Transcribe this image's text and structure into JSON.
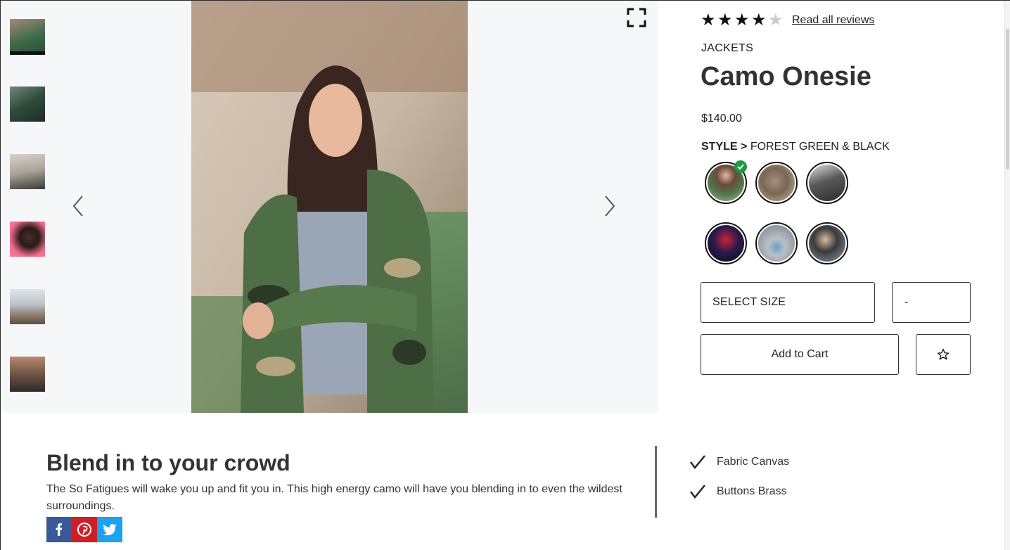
{
  "product": {
    "rating_stars": 4,
    "rating_max": 5,
    "reviews_link": "Read all reviews",
    "category": "JACKETS",
    "title": "Camo Onesie",
    "price": "$140.00",
    "style_label": "STYLE >",
    "style_value": "FOREST GREEN & BLACK",
    "size_select": "SELECT SIZE",
    "qty_select": "-",
    "add_to_cart": "Add to Cart"
  },
  "description": {
    "heading": "Blend in to your crowd",
    "body": "The So Fatigues will wake you up and fit you in. This high energy camo will have you blending in to even the wildest surroundings."
  },
  "features": [
    {
      "label": "Fabric Canvas"
    },
    {
      "label": "Buttons Brass"
    }
  ],
  "social": {
    "facebook_color": "#3b5998",
    "pinterest_color": "#cb2027",
    "twitter_color": "#1da1f2"
  },
  "icons": [
    "expand-icon",
    "chevron-left-icon",
    "chevron-right-icon",
    "star-icon",
    "check-icon",
    "facebook-icon",
    "pinterest-icon",
    "twitter-icon"
  ]
}
